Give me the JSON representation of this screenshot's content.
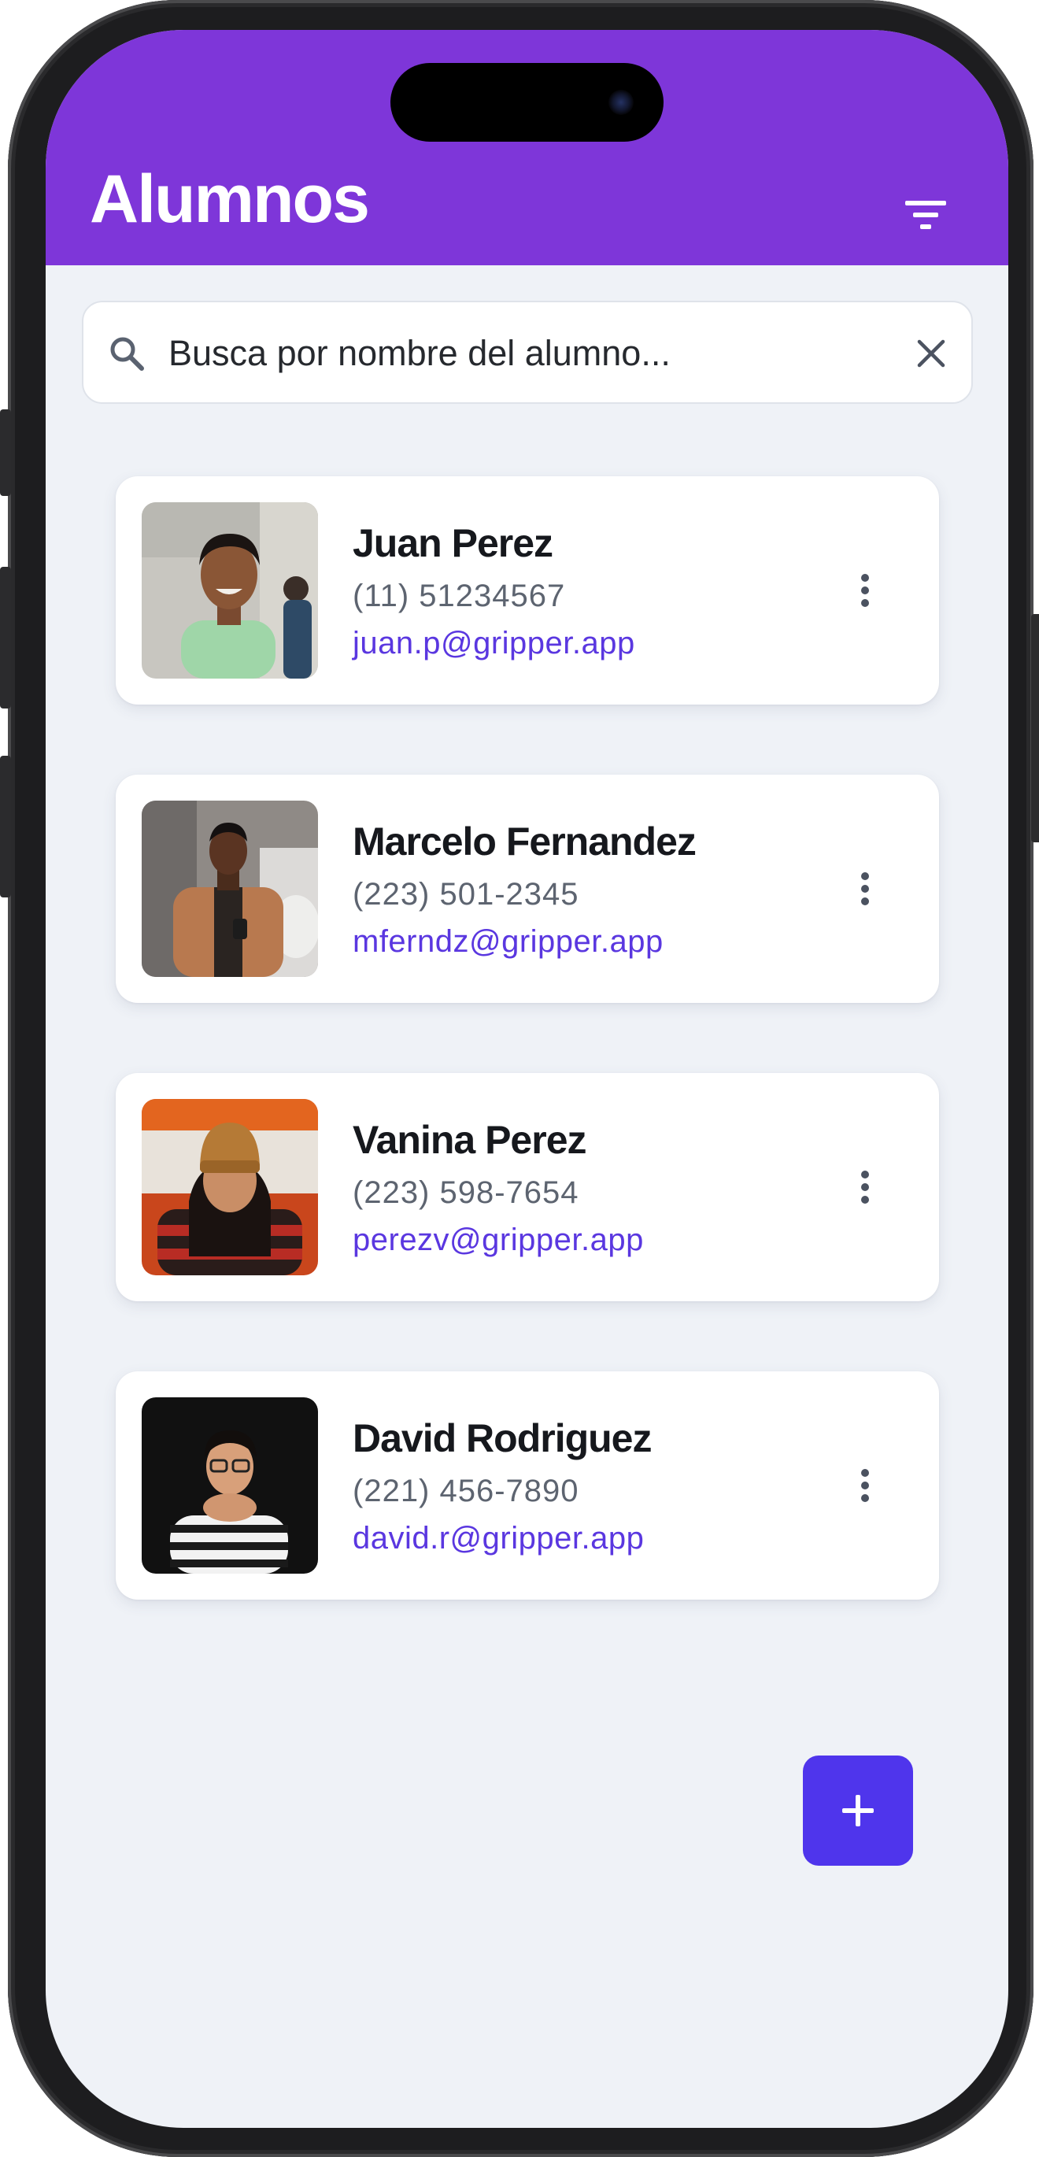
{
  "header": {
    "title": "Alumnos",
    "filter_icon": "filter-icon",
    "background": "#7e36d9"
  },
  "search": {
    "placeholder": "Busca por nombre del alumno...",
    "value": "",
    "search_icon": "search-icon",
    "clear_icon": "close-icon"
  },
  "students": [
    {
      "name": "Juan Perez",
      "phone": "(11) 51234567",
      "email": "juan.p@gripper.app"
    },
    {
      "name": "Marcelo Fernandez",
      "phone": "(223) 501-2345",
      "email": "mferndz@gripper.app"
    },
    {
      "name": "Vanina Perez",
      "phone": "(223) 598-7654",
      "email": "perezv@gripper.app"
    },
    {
      "name": "David Rodriguez",
      "phone": "(221) 456-7890",
      "email": "david.r@gripper.app"
    }
  ],
  "card_menu_icon": "more-vertical-icon",
  "fab": {
    "icon": "plus-icon",
    "color": "#4f35ec"
  },
  "colors": {
    "accent": "#5a37e0",
    "background": "#eff2f7",
    "card": "#ffffff"
  }
}
